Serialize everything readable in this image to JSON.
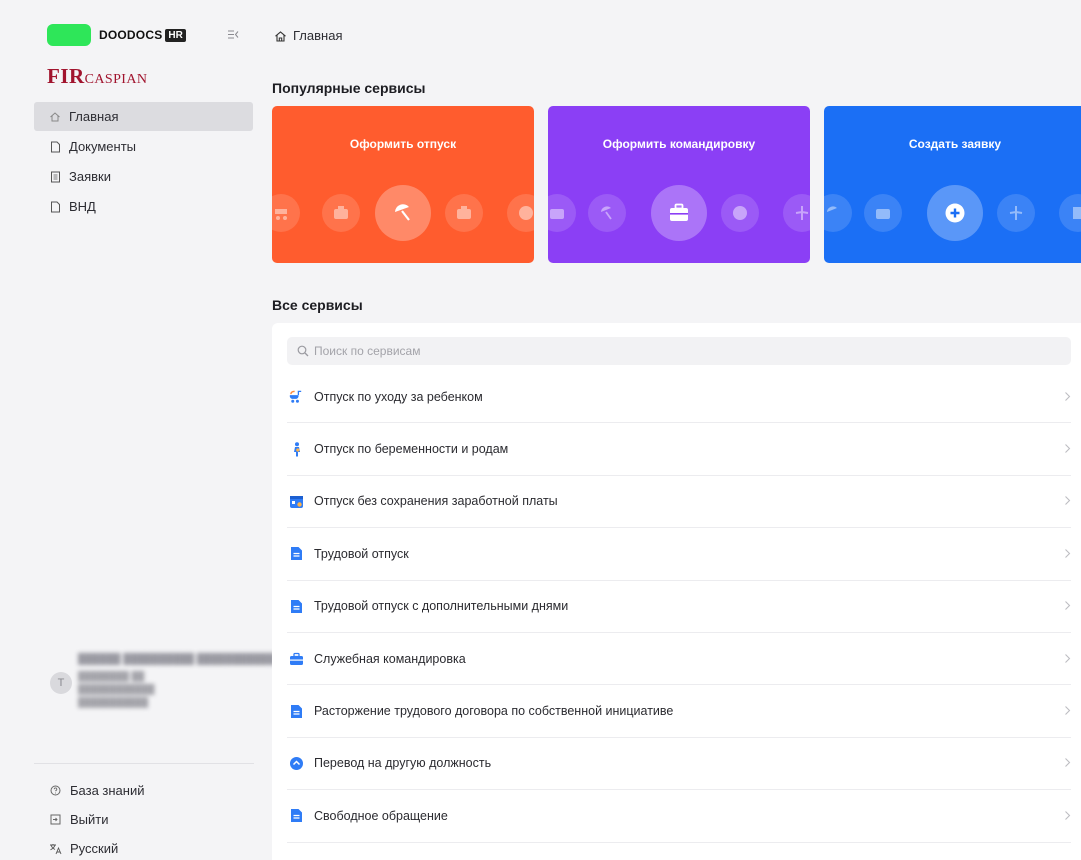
{
  "brand": {
    "name": "DOODOCS",
    "badge": "HR",
    "color": "#2ee659"
  },
  "company_logo": {
    "big": "FIR",
    "small": "CASPIAN",
    "color": "#a1142e"
  },
  "nav": {
    "items": [
      {
        "label": "Главная",
        "icon": "home-icon",
        "active": true
      },
      {
        "label": "Документы",
        "icon": "document-icon",
        "active": false
      },
      {
        "label": "Заявки",
        "icon": "requests-icon",
        "active": false
      },
      {
        "label": "ВНД",
        "icon": "document-icon",
        "active": false
      }
    ]
  },
  "user": {
    "initial": "Т"
  },
  "bottom_links": [
    {
      "label": "База знаний",
      "icon": "help-circle-icon"
    },
    {
      "label": "Выйти",
      "icon": "logout-icon"
    },
    {
      "label": "Русский",
      "icon": "translate-icon"
    }
  ],
  "breadcrumb": {
    "label": "Главная"
  },
  "popular": {
    "title": "Популярные сервисы",
    "cards": [
      {
        "title": "Оформить отпуск",
        "color": "#ff5c2e",
        "center_icon": "umbrella-icon"
      },
      {
        "title": "Оформить командировку",
        "color": "#8b3ff5",
        "center_icon": "briefcase-icon"
      },
      {
        "title": "Создать заявку",
        "color": "#1b6ff5",
        "center_icon": "plus-circle-icon"
      }
    ]
  },
  "all_services": {
    "title": "Все сервисы",
    "search_placeholder": "Поиск по сервисам",
    "items": [
      {
        "label": "Отпуск по уходу за ребенком",
        "icon": "stroller-icon"
      },
      {
        "label": "Отпуск по беременности и родам",
        "icon": "person-icon"
      },
      {
        "label": "Отпуск без сохранения заработной платы",
        "icon": "calendar-icon"
      },
      {
        "label": "Трудовой отпуск",
        "icon": "file-icon"
      },
      {
        "label": "Трудовой отпуск с дополнительными днями",
        "icon": "file-icon"
      },
      {
        "label": "Служебная командировка",
        "icon": "briefcase-icon"
      },
      {
        "label": "Расторжение трудового договора по собственной инициативе",
        "icon": "file-icon"
      },
      {
        "label": "Перевод на другую должность",
        "icon": "transfer-icon"
      },
      {
        "label": "Свободное обращение",
        "icon": "file-icon"
      }
    ]
  },
  "accent": "#2f7cf6"
}
